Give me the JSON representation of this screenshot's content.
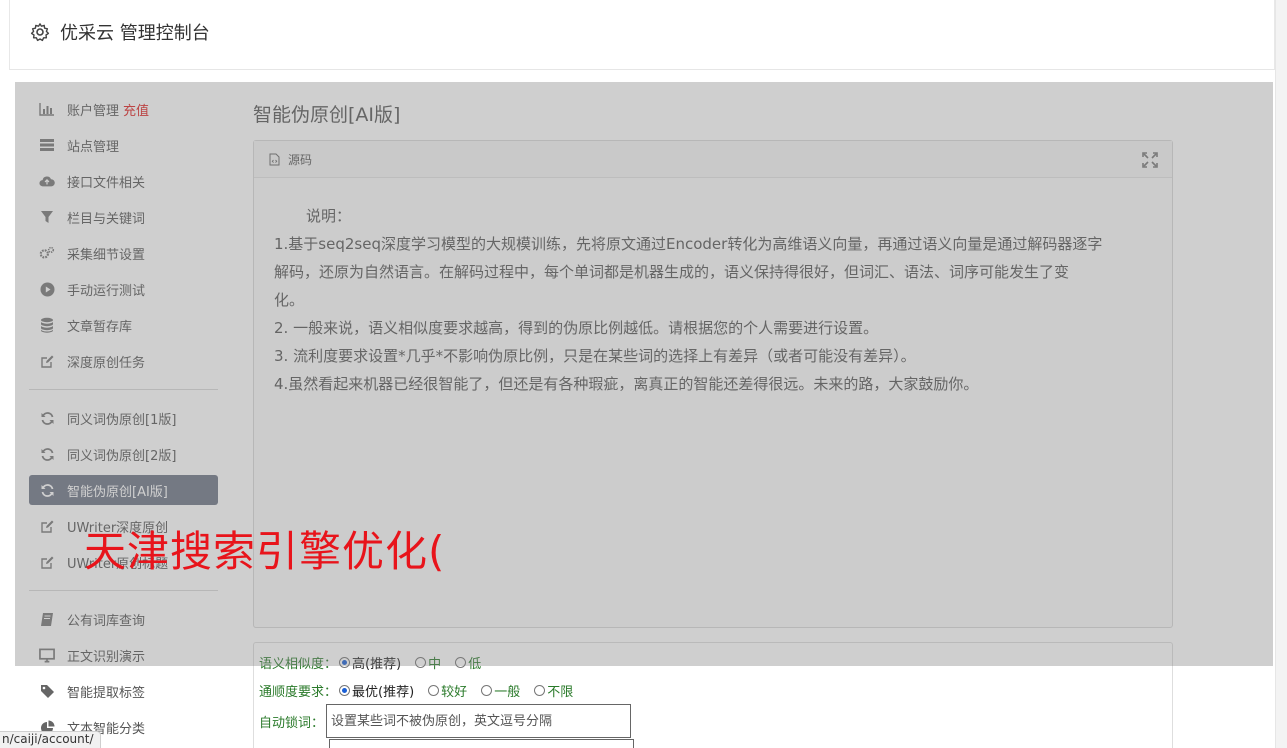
{
  "header": {
    "title": "优采云 管理控制台",
    "icon": "gear-icon"
  },
  "sidebar": {
    "group1": [
      {
        "label": "账户管理",
        "badge": "充值",
        "icon": "bar-chart-icon"
      },
      {
        "label": "站点管理",
        "icon": "server-icon"
      },
      {
        "label": "接口文件相关",
        "icon": "cloud-upload-icon"
      },
      {
        "label": "栏目与关键词",
        "icon": "filter-icon"
      },
      {
        "label": "采集细节设置",
        "icon": "gears-icon"
      },
      {
        "label": "手动运行测试",
        "icon": "play-icon"
      },
      {
        "label": "文章暂存库",
        "icon": "database-icon"
      },
      {
        "label": "深度原创任务",
        "icon": "edit-icon"
      }
    ],
    "group2": [
      {
        "label": "同义词伪原创[1版]",
        "icon": "refresh-icon"
      },
      {
        "label": "同义词伪原创[2版]",
        "icon": "refresh-icon"
      },
      {
        "label": "智能伪原创[AI版]",
        "icon": "refresh-icon",
        "active": true
      },
      {
        "label": "UWriter深度原创",
        "icon": "edit-icon"
      },
      {
        "label": "UWriter原创标题",
        "icon": "edit-icon"
      }
    ],
    "group3": [
      {
        "label": "公有词库查询",
        "icon": "book-icon"
      },
      {
        "label": "正文识别演示",
        "icon": "monitor-icon"
      },
      {
        "label": "智能提取标签",
        "icon": "tag-icon"
      },
      {
        "label": "文本智能分类",
        "icon": "pie-chart-icon"
      }
    ]
  },
  "main": {
    "title": "智能伪原创[AI版]",
    "panel": {
      "head": "源码",
      "desc_title": "说明：",
      "lines": [
        "1.基于seq2seq深度学习模型的大规模训练，先将原文通过Encoder转化为高维语义向量，再通过语义向量是通过解码器逐字",
        "解码，还原为自然语言。在解码过程中，每个单词都是机器生成的，语义保持得很好，但词汇、语法、词序可能发生了变",
        "化。",
        "2. 一般来说，语义相似度要求越高，得到的伪原比例越低。请根据您的个人需要进行设置。",
        "3. 流利度要求设置*几乎*不影响伪原比例，只是在某些词的选择上有差异（或者可能没有差异）。",
        "4.虽然看起来机器已经很智能了，但还是有各种瑕疵，离真正的智能还差得很远。未来的路，大家鼓励你。"
      ]
    },
    "form": {
      "similarity": {
        "label": "语义相似度：",
        "options": [
          "高(推荐)",
          "中",
          "低"
        ],
        "selected": "高(推荐)"
      },
      "fluency": {
        "label": "通顺度要求：",
        "options": [
          "最优(推荐)",
          "较好",
          "一般",
          "不限"
        ],
        "selected": "最优(推荐)"
      },
      "autolock": {
        "label": "自动锁词：",
        "placeholder": "设置某些词不被伪原创，英文逗号分隔"
      }
    }
  },
  "watermark": "天津搜索引擎优化(",
  "status_url": "n/caiji/account/"
}
